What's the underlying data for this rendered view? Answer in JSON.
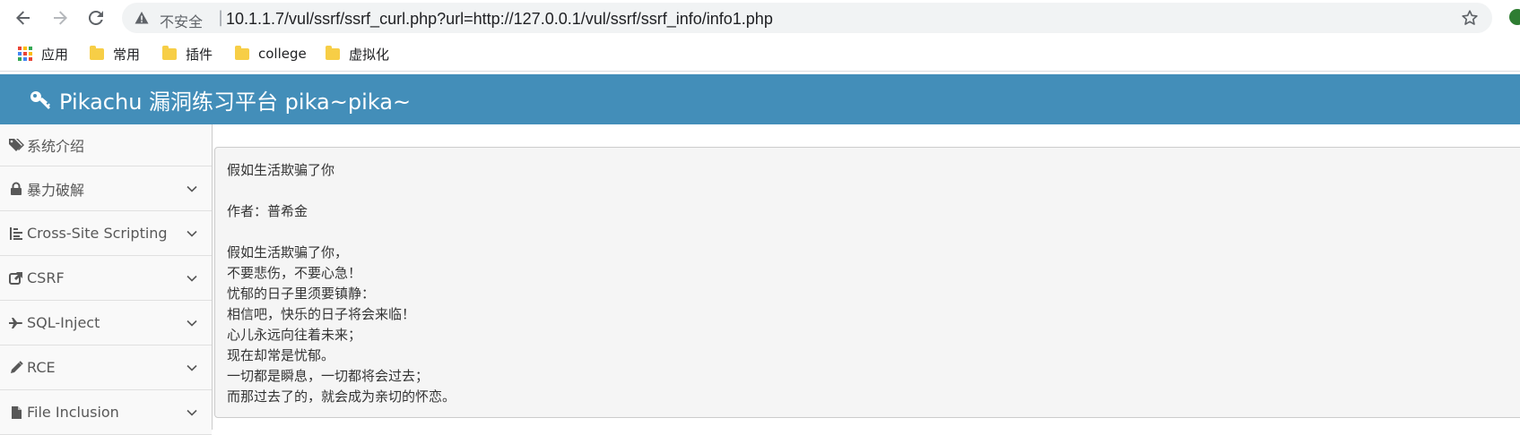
{
  "browser": {
    "security_label": "不安全",
    "separator": "|",
    "url": "10.1.1.7/vul/ssrf/ssrf_curl.php?url=http://127.0.0.1/vul/ssrf/ssrf_info/info1.php",
    "nav_icons": {
      "back": "arrow-left-icon",
      "forward": "arrow-right-icon",
      "reload": "reload-icon"
    }
  },
  "bookmarks": {
    "items": [
      {
        "label": "应用",
        "icon": "apps-grid-icon"
      },
      {
        "label": "常用",
        "icon": "folder-icon"
      },
      {
        "label": "插件",
        "icon": "folder-icon"
      },
      {
        "label": "college",
        "icon": "folder-icon"
      },
      {
        "label": "虚拟化",
        "icon": "folder-icon"
      }
    ]
  },
  "app": {
    "title": "Pikachu 漏洞练习平台 pika~pika~",
    "header_color": "#438eb9"
  },
  "sidebar": {
    "items": [
      {
        "label": "系统介绍",
        "icon": "tags-icon",
        "expandable": false
      },
      {
        "label": "暴力破解",
        "icon": "lock-icon",
        "expandable": true
      },
      {
        "label": "Cross-Site Scripting",
        "icon": "list-indent-icon",
        "expandable": true
      },
      {
        "label": "CSRF",
        "icon": "share-icon",
        "expandable": true
      },
      {
        "label": "SQL-Inject",
        "icon": "plane-icon",
        "expandable": true
      },
      {
        "label": "RCE",
        "icon": "pencil-icon",
        "expandable": true
      },
      {
        "label": "File Inclusion",
        "icon": "file-icon",
        "expandable": true
      }
    ]
  },
  "content": {
    "title": "假如生活欺骗了你",
    "author": "作者：普希金",
    "lines": [
      "假如生活欺骗了你，",
      "不要悲伤，不要心急！",
      "忧郁的日子里须要镇静：",
      "相信吧，快乐的日子将会来临！",
      "心儿永远向往着未来；",
      "现在却常是忧郁。",
      "一切都是瞬息，一切都将会过去；",
      "而那过去了的，就会成为亲切的怀恋。"
    ]
  }
}
